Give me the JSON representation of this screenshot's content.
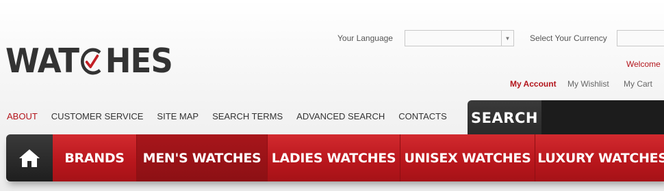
{
  "logo": {
    "part1": "WAT",
    "part2": "HES"
  },
  "header": {
    "language_label": "Your Language",
    "language_value": "",
    "currency_label": "Select Your Currency",
    "currency_value": "",
    "welcome": "Welcome",
    "links": [
      "My Account",
      "My Wishlist",
      "My Cart"
    ]
  },
  "topnav": [
    "ABOUT",
    "CUSTOMER SERVICE",
    "SITE MAP",
    "SEARCH TERMS",
    "ADVANCED SEARCH",
    "CONTACTS"
  ],
  "search": {
    "label": "SEARCH"
  },
  "mainnav": [
    "BRANDS",
    "MEN'S WATCHES",
    "LADIES WATCHES",
    "UNISEX WATCHES",
    "LUXURY WATCHES"
  ],
  "colors": {
    "brand_red": "#c21e24",
    "dark": "#2a2a2a"
  },
  "icons": {
    "home": "home-icon",
    "dropdown": "chevron-down-icon",
    "logo_clock": "clock-check-icon"
  }
}
